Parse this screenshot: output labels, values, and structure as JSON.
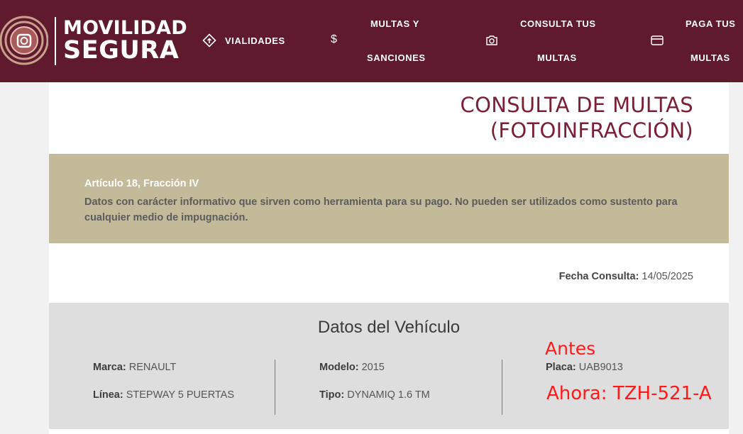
{
  "header": {
    "logo": {
      "line1": "MOVILIDAD",
      "line2": "SEGURA"
    },
    "nav": [
      {
        "label": "VIALIDADES",
        "icon": "road-sign-icon"
      },
      {
        "label_top": "MULTAS Y",
        "label_bottom": "SANCIONES",
        "icon": "dollar-icon"
      },
      {
        "label_top": "CONSULTA TUS",
        "label_bottom": "MULTAS",
        "icon": "camera-icon"
      },
      {
        "label_top": "PAGA TUS",
        "label_bottom": "MULTAS",
        "icon": "credit-card-icon"
      }
    ]
  },
  "page": {
    "title_line1": "CONSULTA DE MULTAS",
    "title_line2": "(FOTOINFRACCIÓN)"
  },
  "notice": {
    "title": "Artículo 18, Fracción IV",
    "text": "Datos con carácter informativo que sirven como herramienta para su pago. No pueden ser utilizados como sustento para cualquier medio de impugnación."
  },
  "consulta": {
    "label": "Fecha Consulta:",
    "value": "14/05/2025"
  },
  "vehicle": {
    "title": "Datos del Vehículo",
    "marca": {
      "label": "Marca:",
      "value": "RENAULT"
    },
    "linea": {
      "label": "Línea:",
      "value": "STEPWAY 5 PUERTAS"
    },
    "modelo": {
      "label": "Modelo:",
      "value": "2015"
    },
    "tipo": {
      "label": "Tipo:",
      "value": "DYNAMIQ 1.6 TM"
    },
    "placa": {
      "label": "Placa:",
      "value": "UAB9013"
    }
  },
  "annotations": {
    "before": "Antes",
    "after": "Ahora: TZH-521-A"
  },
  "colors": {
    "header_bg": "#5f1a2d",
    "title": "#7b1f35",
    "notice_bg": "#c2ba99",
    "vehicle_bg": "#dedede",
    "annotation": "#ff1a1a"
  }
}
